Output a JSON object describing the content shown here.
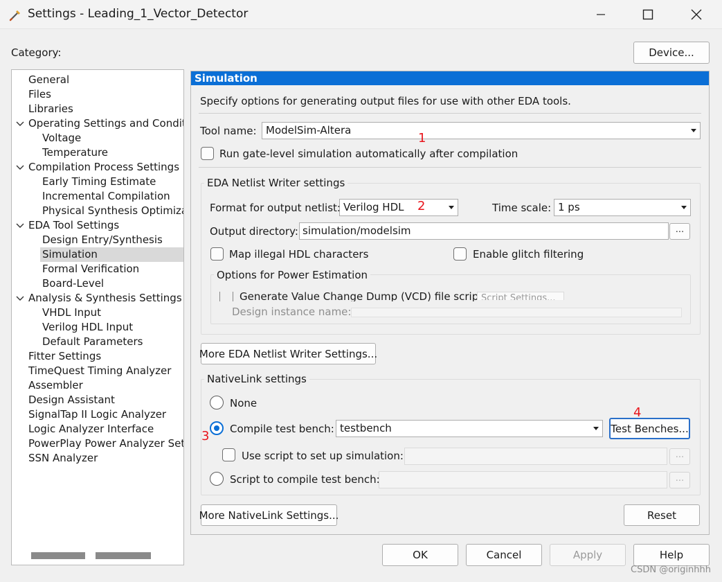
{
  "window": {
    "title": "Settings - Leading_1_Vector_Detector"
  },
  "category_label": "Category:",
  "device_button": "Device...",
  "tree": [
    {
      "label": "General",
      "level": 0,
      "expanded": false,
      "selected": false
    },
    {
      "label": "Files",
      "level": 0,
      "expanded": false,
      "selected": false
    },
    {
      "label": "Libraries",
      "level": 0,
      "expanded": false,
      "selected": false
    },
    {
      "label": "Operating Settings and Conditions",
      "level": 0,
      "expanded": true,
      "selected": false
    },
    {
      "label": "Voltage",
      "level": 1,
      "expanded": false,
      "selected": false
    },
    {
      "label": "Temperature",
      "level": 1,
      "expanded": false,
      "selected": false
    },
    {
      "label": "Compilation Process Settings",
      "level": 0,
      "expanded": true,
      "selected": false
    },
    {
      "label": "Early Timing Estimate",
      "level": 1,
      "expanded": false,
      "selected": false
    },
    {
      "label": "Incremental Compilation",
      "level": 1,
      "expanded": false,
      "selected": false
    },
    {
      "label": "Physical Synthesis Optimizations",
      "level": 1,
      "expanded": false,
      "selected": false
    },
    {
      "label": "EDA Tool Settings",
      "level": 0,
      "expanded": true,
      "selected": false
    },
    {
      "label": "Design Entry/Synthesis",
      "level": 1,
      "expanded": false,
      "selected": false
    },
    {
      "label": "Simulation",
      "level": 1,
      "expanded": false,
      "selected": true
    },
    {
      "label": "Formal Verification",
      "level": 1,
      "expanded": false,
      "selected": false
    },
    {
      "label": "Board-Level",
      "level": 1,
      "expanded": false,
      "selected": false
    },
    {
      "label": "Analysis & Synthesis Settings",
      "level": 0,
      "expanded": true,
      "selected": false
    },
    {
      "label": "VHDL Input",
      "level": 1,
      "expanded": false,
      "selected": false
    },
    {
      "label": "Verilog HDL Input",
      "level": 1,
      "expanded": false,
      "selected": false
    },
    {
      "label": "Default Parameters",
      "level": 1,
      "expanded": false,
      "selected": false
    },
    {
      "label": "Fitter Settings",
      "level": 0,
      "expanded": false,
      "selected": false
    },
    {
      "label": "TimeQuest Timing Analyzer",
      "level": 0,
      "expanded": false,
      "selected": false
    },
    {
      "label": "Assembler",
      "level": 0,
      "expanded": false,
      "selected": false
    },
    {
      "label": "Design Assistant",
      "level": 0,
      "expanded": false,
      "selected": false
    },
    {
      "label": "SignalTap II Logic Analyzer",
      "level": 0,
      "expanded": false,
      "selected": false
    },
    {
      "label": "Logic Analyzer Interface",
      "level": 0,
      "expanded": false,
      "selected": false
    },
    {
      "label": "PowerPlay Power Analyzer Settings",
      "level": 0,
      "expanded": false,
      "selected": false
    },
    {
      "label": "SSN Analyzer",
      "level": 0,
      "expanded": false,
      "selected": false
    }
  ],
  "panel": {
    "header": "Simulation",
    "description": "Specify options for generating output files for use with other EDA tools.",
    "tool_name_label": "Tool name:",
    "tool_name_value": "ModelSim-Altera",
    "run_gate_level_label": "Run gate-level simulation automatically after compilation",
    "netlist_group_title": "EDA Netlist Writer settings",
    "format_label": "Format for output netlist:",
    "format_value": "Verilog HDL",
    "time_scale_label": "Time scale:",
    "time_scale_value": "1 ps",
    "output_dir_label": "Output directory:",
    "output_dir_value": "simulation/modelsim",
    "browse_label": "...",
    "map_illegal_label": "Map illegal HDL characters",
    "enable_glitch_label": "Enable glitch filtering",
    "power_group_title": "Options for Power Estimation",
    "vcd_label": "Generate Value Change Dump (VCD) file script",
    "script_settings_label": "Script Settings...",
    "design_instance_label": "Design instance name:",
    "more_netlist_button": "More EDA Netlist Writer Settings...",
    "nativelink_group_title": "NativeLink settings",
    "none_label": "None",
    "compile_tb_label": "Compile test bench:",
    "compile_tb_value": "testbench",
    "test_benches_button": "Test Benches...",
    "use_script_label": "Use script to set up simulation:",
    "script_compile_label": "Script to compile test bench:",
    "more_nativelink_button": "More NativeLink Settings...",
    "reset_button": "Reset"
  },
  "annotations": [
    "1",
    "2",
    "3",
    "4"
  ],
  "footer": {
    "ok": "OK",
    "cancel": "Cancel",
    "apply": "Apply",
    "help": "Help"
  },
  "watermark": "CSDN @originhhh",
  "colors": {
    "accent": "#0b6fd6",
    "annotation": "#e8141b",
    "selection": "#d9d9d9"
  }
}
